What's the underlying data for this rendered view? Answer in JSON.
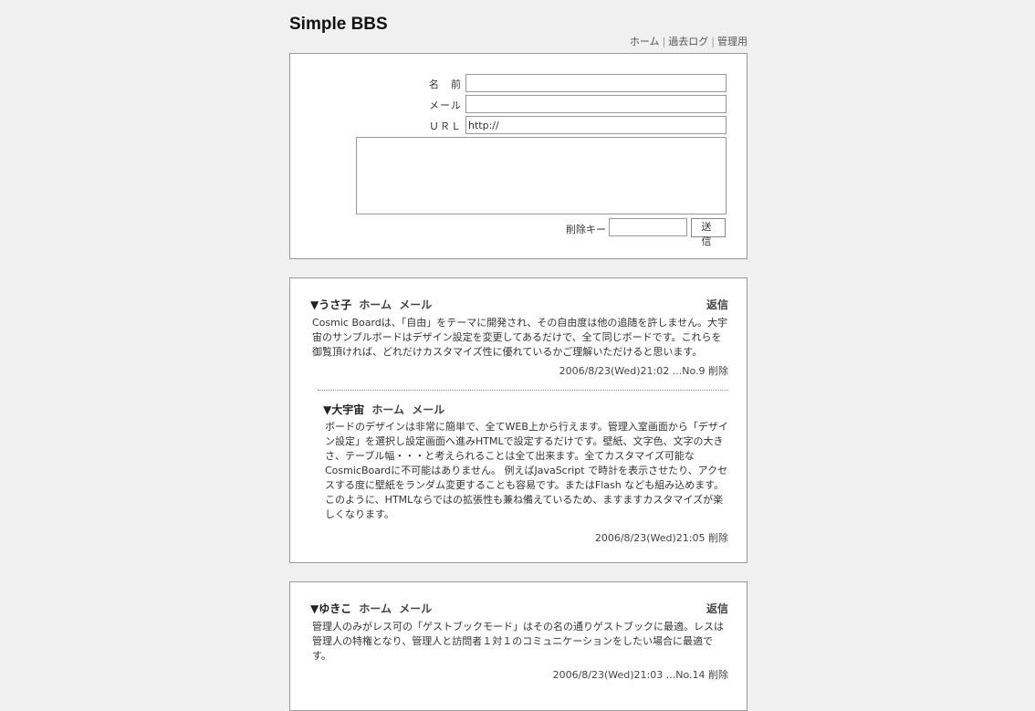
{
  "site": {
    "title": "Simple BBS",
    "nav": [
      "ホーム",
      "過去ログ",
      "管理用"
    ]
  },
  "form": {
    "name_label": "名　前",
    "email_label": "メール",
    "url_label": "ＵＲＬ",
    "url_value": "http://",
    "delete_key_label": "削除キー",
    "submit_label": "送　信"
  },
  "posts": [
    {
      "author": "▼うさ子",
      "home_label": "ホーム",
      "mail_label": "メール",
      "reply_label": "返信",
      "body": "Cosmic Boardは、「自由」をテーマに開発され、その自由度は他の追随を許しません。大宇宙のサンプルボードはデザイン設定を変更してあるだけで、全て同じボードです。これらを御覧頂ければ、どれだけカスタマイズ性に優れているかご理解いただけると思います。",
      "date": "2006/8/23(Wed)21:02 ...No.9",
      "delete_label": "削除",
      "replies": [
        {
          "author": "▼大宇宙",
          "home_label": "ホーム",
          "mail_label": "メール",
          "body": "ボードのデザインは非常に簡単で、全てWEB上から行えます。管理入室画面から「デザイン設定」を選択し設定画面へ進みHTMLで設定するだけです。壁紙、文字色、文字の大きさ、テーブル幅・・・と考えられることは全て出来ます。全てカスタマイズ可能なCosmicBoardに不可能はありません。 例えばJavaScript で時計を表示させたり、アクセスする度に壁紙をランダム変更することも容易です。またはFlash なども組み込めます。このように、HTMLならではの拡張性も兼ね備えているため、ますますカスタマイズが楽しくなります。",
          "date": "2006/8/23(Wed)21:05",
          "delete_label": "削除"
        }
      ]
    },
    {
      "author": "▼ゆきこ",
      "home_label": "ホーム",
      "mail_label": "メール",
      "reply_label": "返信",
      "body": "管理人のみがレス可の「ゲストブックモード」はその名の通りゲストブックに最適。レスは管理人の特権となり、管理人と訪問者１対１のコミュニケーションをしたい場合に最適です。",
      "date": "2006/8/23(Wed)21:03 ...No.14",
      "delete_label": "削除"
    }
  ]
}
